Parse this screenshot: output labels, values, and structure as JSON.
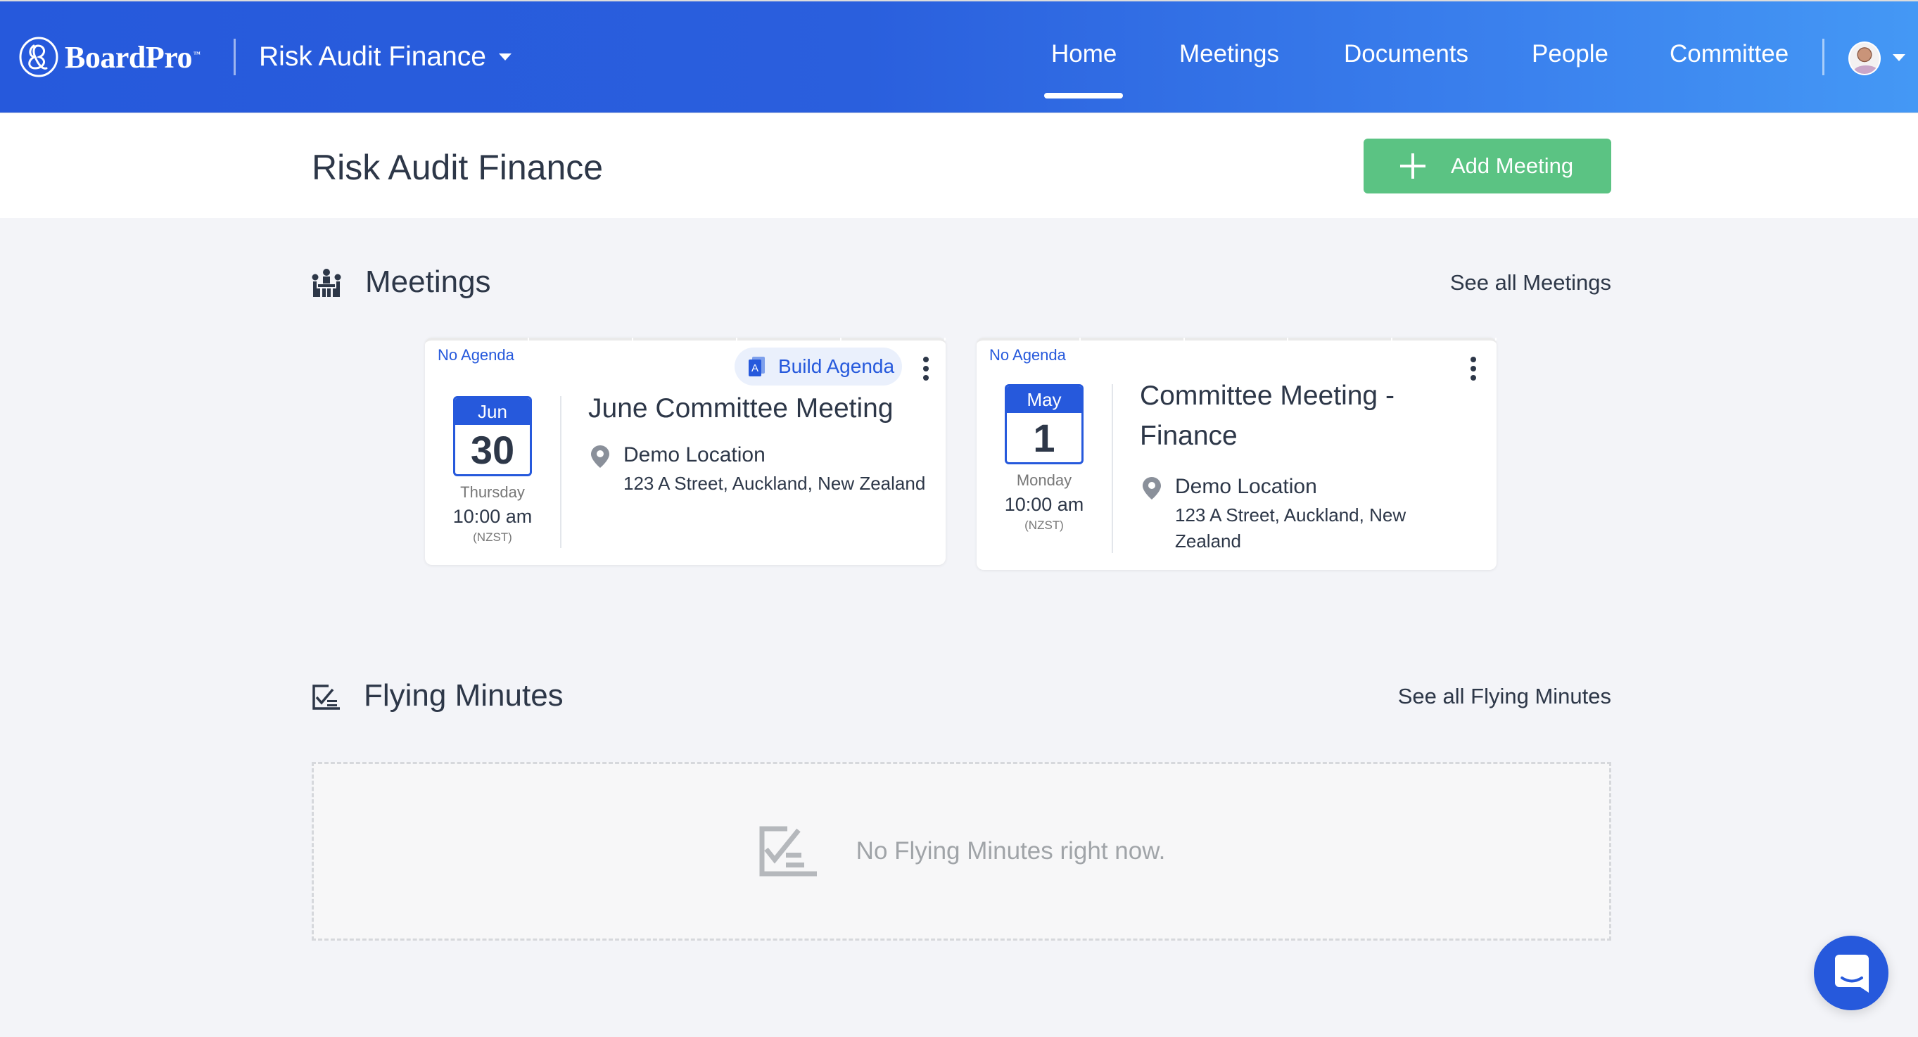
{
  "app": {
    "brand": "BoardPro",
    "brand_tm": "™",
    "workspace": "Risk Audit Finance"
  },
  "nav": {
    "items": [
      {
        "label": "Home",
        "active": true
      },
      {
        "label": "Meetings",
        "active": false
      },
      {
        "label": "Documents",
        "active": false
      },
      {
        "label": "People",
        "active": false
      },
      {
        "label": "Committee",
        "active": false
      }
    ],
    "user_avatar": "user-avatar-photo"
  },
  "page": {
    "title": "Risk Audit Finance",
    "add_meeting_label": "Add Meeting"
  },
  "meetings_section": {
    "title": "Meetings",
    "see_all": "See all Meetings",
    "icon": "meeting-table-icon",
    "cards": [
      {
        "agenda_status": "No Agenda",
        "build_agenda_label": "Build Agenda",
        "month": "Jun",
        "day": "30",
        "weekday": "Thursday",
        "time": "10:00 am",
        "timezone": "(NZST)",
        "title": "June Committee Meeting",
        "location_name": "Demo Location",
        "location_address": "123 A Street, Auckland, New Zealand"
      },
      {
        "agenda_status": "No Agenda",
        "month": "May",
        "day": "1",
        "weekday": "Monday",
        "time": "10:00 am",
        "timezone": "(NZST)",
        "title": "Committee Meeting - Finance",
        "location_name": "Demo Location",
        "location_address": "123 A Street, Auckland, New Zealand"
      }
    ]
  },
  "flying_minutes_section": {
    "title": "Flying Minutes",
    "see_all": "See all Flying Minutes",
    "icon": "checklist-icon",
    "empty_message": "No Flying Minutes right now."
  },
  "colors": {
    "brand_blue": "#2659dc",
    "nav_gradient_end": "#4498f5",
    "add_button_green": "#5bc383",
    "text_dark": "#2d3748",
    "page_bg": "#f3f4f8"
  }
}
